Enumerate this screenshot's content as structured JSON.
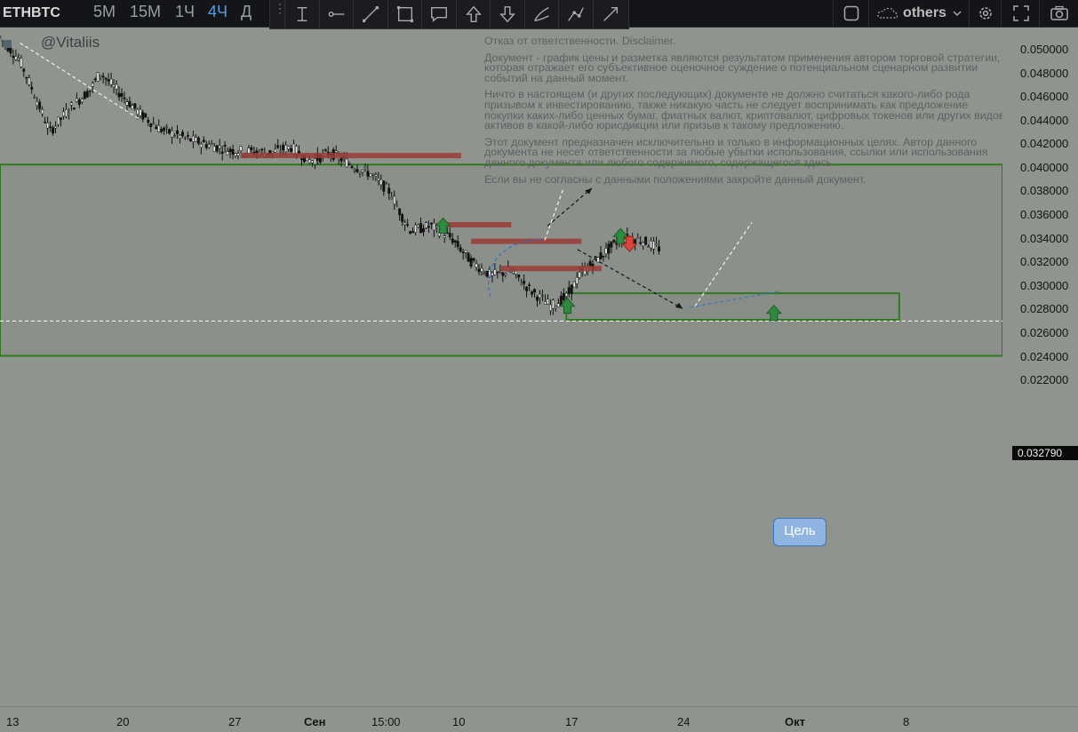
{
  "toolbar": {
    "symbol": "ETHBTC",
    "timeframes": [
      {
        "label": "5M",
        "active": false
      },
      {
        "label": "15M",
        "active": false
      },
      {
        "label": "1Ч",
        "active": false
      },
      {
        "label": "4Ч",
        "active": true
      },
      {
        "label": "Д",
        "active": false
      }
    ],
    "drawing_tools": [
      "text-anchor-icon",
      "horizontal-ray-icon",
      "trend-line-icon",
      "rectangle-icon",
      "callout-icon",
      "arrow-up-icon",
      "arrow-down-icon",
      "brush-icon",
      "path-icon",
      "arrow-line-icon"
    ],
    "layout_icon": "layout-square-icon",
    "others_label": "others",
    "right_icons": [
      "gear-icon",
      "fullscreen-icon",
      "camera-icon"
    ]
  },
  "watermark": "@Vitaliis",
  "disclaimer": {
    "lines": [
      "Отказ от ответственности. Disclaimer.",
      "Документ - график цены и разметка являются результатом применения автором торговой стратегии, которая отражает его субъективное оценочное суждение о потенциальном сценарном развитии событий на данный момент.",
      "Ничто в настоящем (и других последующих) документе не должно считаться какого-либо рода призывом к инвестированию, также никакую часть не следует воспринимать как предложение покупки каких-либо ценных бумаг, фиатных валют, криптовалют, цифровых токенов или других видов активов в какой-либо юрисдикции или призыв к такому предложению.",
      "Этот документ предназначен исключительно и только в информационных целях. Автор данного документа не несет ответственности за любые убытки использования, ссылки или использования данного документа или любого содержимого, содержащегося здесь.",
      "Если вы не согласны с данными положениями закройте данный документ."
    ]
  },
  "annotation": {
    "target_label": "Цель"
  },
  "colors": {
    "background": "#8f948e",
    "zone_border": "#2f7a1c",
    "resistance": "#9b3b36",
    "arrow_up": "#2e8b3e",
    "arrow_down": "#d9433a",
    "callout_fill": "#8fb4e2",
    "curve": "#2f6fd0"
  },
  "chart_data": {
    "type": "candlestick",
    "symbol": "ETHBTC",
    "timeframe": "4Ч",
    "y_ticks": [
      "0.050000",
      "0.048000",
      "0.046000",
      "0.044000",
      "0.042000",
      "0.040000",
      "0.038000",
      "0.036000",
      "0.034000",
      "0.032000",
      "0.030000",
      "0.028000",
      "0.026000",
      "0.024000",
      "0.022000"
    ],
    "x_ticks": [
      {
        "label": "13",
        "bold": false
      },
      {
        "label": "20",
        "bold": false
      },
      {
        "label": "27",
        "bold": false
      },
      {
        "label": "Сен",
        "bold": true
      },
      {
        "label": "15:00",
        "bold": false
      },
      {
        "label": "10",
        "bold": false
      },
      {
        "label": "17",
        "bold": false
      },
      {
        "label": "24",
        "bold": false
      },
      {
        "label": "Окт",
        "bold": true
      },
      {
        "label": "8",
        "bold": false
      }
    ],
    "current_price": "0.032790",
    "ylim": [
      0.0218,
      0.051
    ],
    "price_path": [
      [
        0,
        0.051
      ],
      [
        0.02,
        0.049
      ],
      [
        0.04,
        0.045
      ],
      [
        0.05,
        0.043
      ],
      [
        0.07,
        0.045
      ],
      [
        0.09,
        0.0465
      ],
      [
        0.1,
        0.048
      ],
      [
        0.12,
        0.0462
      ],
      [
        0.14,
        0.0445
      ],
      [
        0.16,
        0.0432
      ],
      [
        0.19,
        0.0423
      ],
      [
        0.23,
        0.0414
      ],
      [
        0.27,
        0.0412
      ],
      [
        0.29,
        0.0417
      ],
      [
        0.31,
        0.0405
      ],
      [
        0.33,
        0.0412
      ],
      [
        0.35,
        0.0402
      ],
      [
        0.37,
        0.0394
      ],
      [
        0.39,
        0.0378
      ],
      [
        0.4,
        0.036
      ],
      [
        0.41,
        0.0346
      ],
      [
        0.43,
        0.035
      ],
      [
        0.45,
        0.034
      ],
      [
        0.47,
        0.032
      ],
      [
        0.49,
        0.0308
      ],
      [
        0.51,
        0.0312
      ],
      [
        0.53,
        0.0295
      ],
      [
        0.55,
        0.0282
      ],
      [
        0.565,
        0.029
      ],
      [
        0.58,
        0.031
      ],
      [
        0.6,
        0.0325
      ],
      [
        0.62,
        0.034
      ],
      [
        0.64,
        0.0338
      ],
      [
        0.66,
        0.033
      ]
    ],
    "resistance_levels": [
      {
        "price": 0.04096,
        "from": 0.24,
        "to": 0.46
      },
      {
        "price": 0.0351,
        "from": 0.44,
        "to": 0.51
      },
      {
        "price": 0.0337,
        "from": 0.47,
        "to": 0.58
      },
      {
        "price": 0.0314,
        "from": 0.5,
        "to": 0.6
      }
    ],
    "zones": [
      {
        "top": 0.0402,
        "bottom": 0.024,
        "from": 0.0,
        "to": 1.0
      },
      {
        "top": 0.0293,
        "bottom": 0.02705,
        "from": 0.565,
        "to": 0.897
      }
    ],
    "dashed_level": 0.02695,
    "arrows_up": [
      {
        "x": 0.442,
        "price": 0.035
      },
      {
        "x": 0.566,
        "price": 0.0282
      },
      {
        "x": 0.619,
        "price": 0.0341
      },
      {
        "x": 0.772,
        "price": 0.0276
      }
    ],
    "arrows_down": [
      {
        "x": 0.628,
        "price": 0.0335
      }
    ]
  }
}
